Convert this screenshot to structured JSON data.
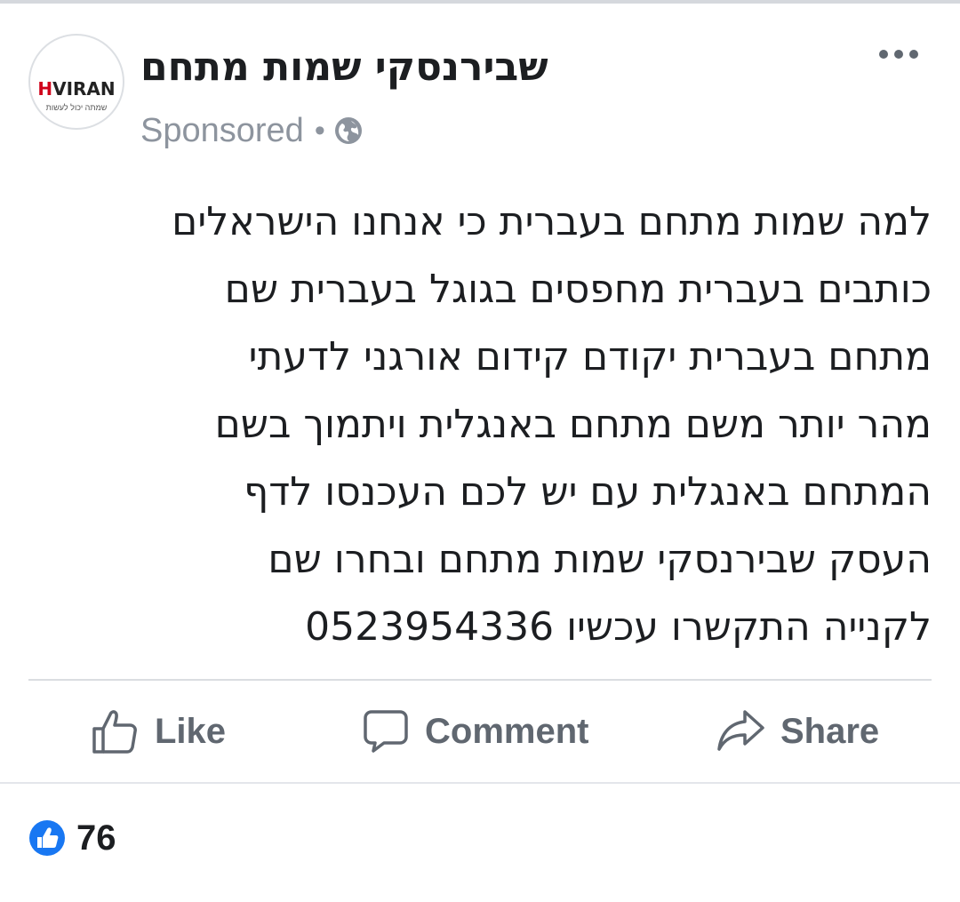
{
  "post": {
    "page_name": "שבירנסקי שמות מתחם",
    "avatar": {
      "brand_red": "H",
      "brand_rest": "VIRAN",
      "tagline": "שמתה יכול לעשות"
    },
    "sponsored_label": "Sponsored",
    "meta_separator": "•",
    "privacy_icon": "globe-icon",
    "more_icon": "more-horizontal-icon",
    "text_lines": [
      "למה שמות מתחם בעברית כי אנחנו הישראלים",
      "כותבים בעברית מחפסים בגוגל בעברית שם",
      "מתחם בעברית יקודם קידום אורגני לדעתי",
      "מהר יותר משם מתחם באנגלית ויתמוך בשם",
      "המתחם באנגלית עם יש לכם העכנסו לדף",
      "העסק שבירנסקי שמות מתחם ובחרו שם",
      "לקנייה התקשרו עכשיו 0523954336"
    ]
  },
  "actions": {
    "like_label": "Like",
    "comment_label": "Comment",
    "share_label": "Share"
  },
  "reactions": {
    "icon": "thumbs-up-reaction-icon",
    "count": "76"
  },
  "colors": {
    "brand_red": "#d0021b",
    "meta_gray": "#8d949e",
    "action_gray": "#606770",
    "reaction_blue": "#1877f2",
    "divider": "#dadde1"
  }
}
